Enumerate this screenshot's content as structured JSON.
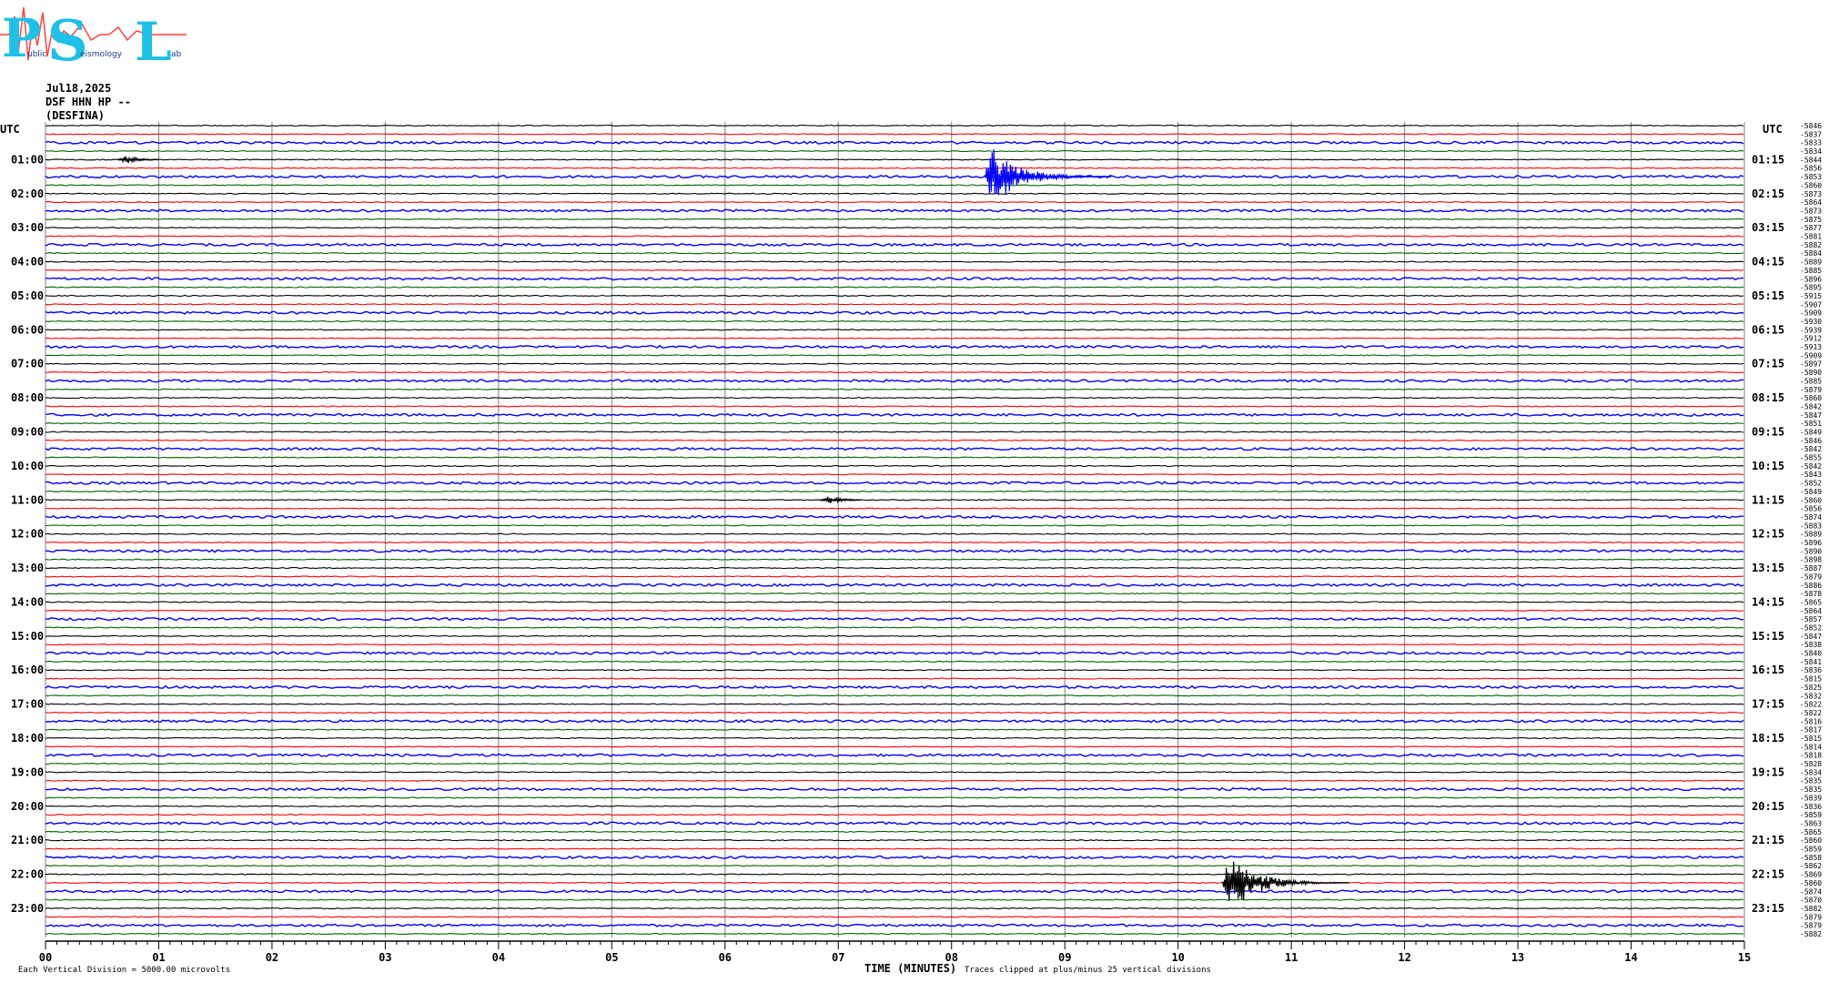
{
  "logo": {
    "letters": "PSL",
    "words": [
      "ublic",
      "eismology",
      "ab"
    ]
  },
  "header": {
    "date": "Jul18,2025",
    "station": "DSF HHN HP --",
    "site": "(DESFINA)"
  },
  "colors": {
    "black": "#000000",
    "red": "#ff0000",
    "blue": "#0000ff",
    "green": "#006400",
    "grid": "#808080"
  },
  "chart_data": {
    "type": "line",
    "title": "",
    "xlabel": "TIME (MINUTES)",
    "x_ticks": [
      "00",
      "01",
      "02",
      "03",
      "04",
      "05",
      "06",
      "07",
      "08",
      "09",
      "10",
      "11",
      "12",
      "13",
      "14",
      "15"
    ],
    "xlim": [
      0,
      15
    ],
    "left_label_top": "UTC",
    "right_label_top": "UTC",
    "left_hours": [
      "01:00",
      "02:00",
      "03:00",
      "04:00",
      "05:00",
      "06:00",
      "07:00",
      "08:00",
      "09:00",
      "10:00",
      "11:00",
      "12:00",
      "13:00",
      "14:00",
      "15:00",
      "16:00",
      "17:00",
      "18:00",
      "19:00",
      "20:00",
      "21:00",
      "22:00",
      "23:00"
    ],
    "right_hours": [
      "01:15",
      "02:15",
      "03:15",
      "04:15",
      "05:15",
      "06:15",
      "07:15",
      "08:15",
      "09:15",
      "10:15",
      "11:15",
      "12:15",
      "13:15",
      "14:15",
      "15:15",
      "16:15",
      "17:15",
      "18:15",
      "19:15",
      "20:15",
      "21:15",
      "22:15",
      "23:15"
    ],
    "trace_color_cycle": [
      "black",
      "red",
      "blue",
      "green"
    ],
    "trace_offsets": [
      "-5846",
      "-5837",
      "-5833",
      "-5834",
      "-5844",
      "-5856",
      "-5853",
      "-5860",
      "-5873",
      "-5864",
      "-5873",
      "-5875",
      "-5877",
      "-5881",
      "-5882",
      "-5884",
      "-5889",
      "-5885",
      "-5896",
      "-5895",
      "-5915",
      "-5907",
      "-5909",
      "-5930",
      "-5939",
      "-5912",
      "-5913",
      "-5909",
      "-5897",
      "-5890",
      "-5885",
      "-5879",
      "-5860",
      "-5842",
      "-5847",
      "-5851",
      "-5849",
      "-5846",
      "-5842",
      "-5855",
      "-5842",
      "-5843",
      "-5852",
      "-5849",
      "-5860",
      "-5856",
      "-5874",
      "-5883",
      "-5889",
      "-5896",
      "-5890",
      "-5898",
      "-5887",
      "-5879",
      "-5886",
      "-5878",
      "-5865",
      "-5864",
      "-5857",
      "-5852",
      "-5847",
      "-5838",
      "-5840",
      "-5841",
      "-5836",
      "-5815",
      "-5825",
      "-5832",
      "-5822",
      "-5822",
      "-5816",
      "-5817",
      "-5815",
      "-5814",
      "-5818",
      "-5828",
      "-5834",
      "-5835",
      "-5835",
      "-5839",
      "-5836",
      "-5859",
      "-5863",
      "-5865",
      "-5860",
      "-5859",
      "-5858",
      "-5862",
      "-5869",
      "-5860",
      "-5874",
      "-5870",
      "-5882",
      "-5879",
      "-5879",
      "-5882"
    ],
    "events": [
      {
        "trace": 4,
        "minute": 0.7,
        "amplitude": "small",
        "color": "black"
      },
      {
        "trace": 6,
        "minute": 8.35,
        "amplitude": "large",
        "color": "blue"
      },
      {
        "trace": 44,
        "minute": 6.9,
        "amplitude": "small",
        "color": "black"
      },
      {
        "trace": 89,
        "minute": 10.45,
        "amplitude": "large",
        "color": "black"
      }
    ],
    "footnote_left": "Each Vertical Division = 5000.00 microvolts",
    "footnote_right": "Traces clipped at plus/minus 25 vertical divisions"
  }
}
